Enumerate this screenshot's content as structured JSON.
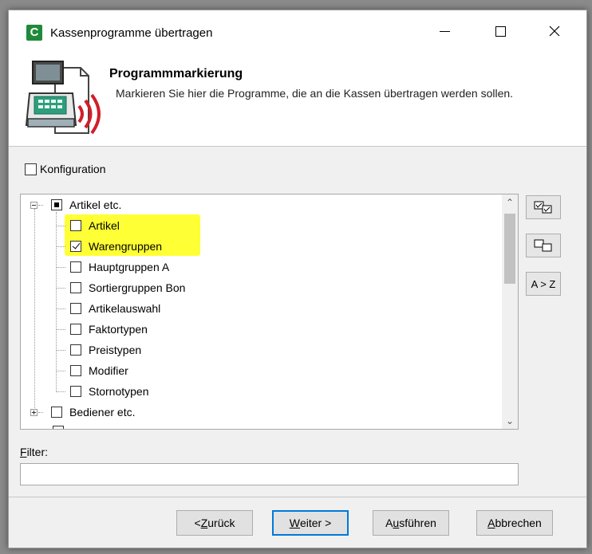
{
  "window": {
    "title": "Kassenprogramme übertragen",
    "icon_letter": "C",
    "icon_color": "#1f8a3a"
  },
  "header": {
    "title": "Programmmarkierung",
    "subtitle": "Markieren Sie hier die Programme, die an die Kassen übertragen werden sollen."
  },
  "config": {
    "label": "Konfiguration",
    "checked": false
  },
  "tree": {
    "groups": [
      {
        "label": "Artikel etc.",
        "state": "partial",
        "expanded": true,
        "children": [
          {
            "label": "Artikel",
            "checked": false
          },
          {
            "label": "Warengruppen",
            "checked": true
          },
          {
            "label": "Hauptgruppen A",
            "checked": false
          },
          {
            "label": "Sortiergruppen Bon",
            "checked": false
          },
          {
            "label": "Artikelauswahl",
            "checked": false
          },
          {
            "label": "Faktortypen",
            "checked": false
          },
          {
            "label": "Preistypen",
            "checked": false
          },
          {
            "label": "Modifier",
            "checked": false
          },
          {
            "label": "Stornotypen",
            "checked": false
          }
        ]
      },
      {
        "label": "Bediener etc.",
        "state": "unchecked",
        "expanded": false
      }
    ],
    "highlight_color": "#ffff2a"
  },
  "side_buttons": {
    "sort_label": "A > Z"
  },
  "filter": {
    "label_accel": "F",
    "label_rest": "ilter:",
    "value": ""
  },
  "buttons": {
    "back_prefix": "< ",
    "back_accel": "Z",
    "back_rest": "urück",
    "next_accel": "W",
    "next_rest": "eiter >",
    "execute_pre": "A",
    "execute_accel": "u",
    "execute_rest": "sführen",
    "cancel_accel": "A",
    "cancel_rest": "bbrechen"
  }
}
